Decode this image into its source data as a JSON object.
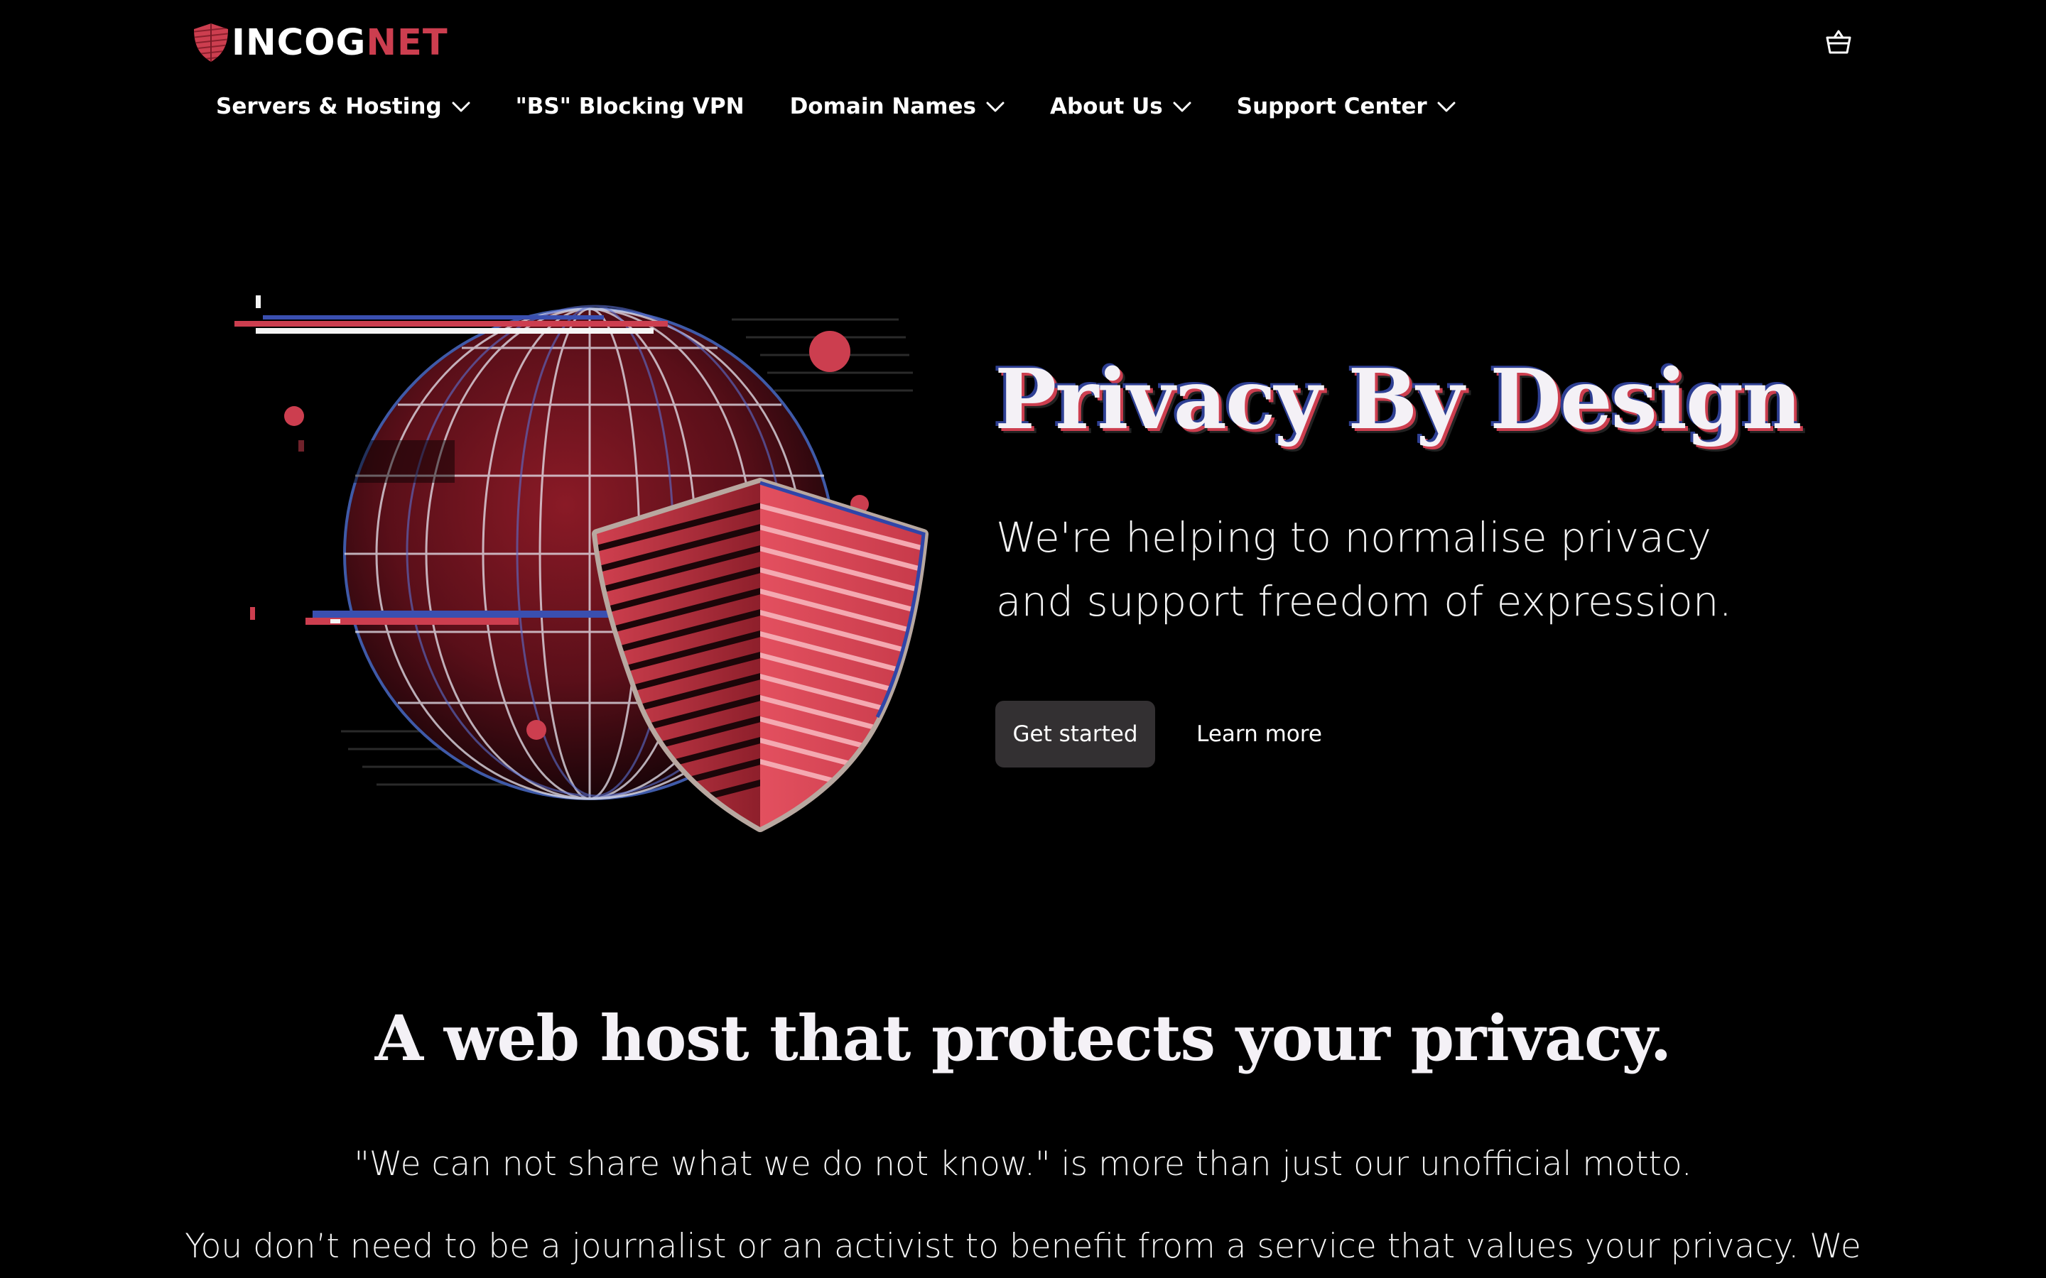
{
  "brand": {
    "name_part1": "INCOG",
    "name_part2": "NET",
    "accent_color": "#cc3e4f",
    "secondary_color": "#2e3f93",
    "logo_icon": "shield-icon"
  },
  "header": {
    "cart_icon": "basket-icon"
  },
  "nav": {
    "items": [
      {
        "label": "Servers & Hosting",
        "has_dropdown": true
      },
      {
        "label": "\"BS\" Blocking VPN",
        "has_dropdown": false
      },
      {
        "label": "Domain Names",
        "has_dropdown": true
      },
      {
        "label": "About Us",
        "has_dropdown": true
      },
      {
        "label": "Support Center",
        "has_dropdown": true
      }
    ],
    "dropdown_icon": "chevron-down-icon"
  },
  "hero": {
    "title": "Privacy By Design",
    "subtitle": "We're helping to normalise privacy and support freedom of expression.",
    "primary_button": "Get started",
    "secondary_button": "Learn more",
    "illustration": "globe-with-shield-illustration"
  },
  "section": {
    "title": "A web host that protects your privacy.",
    "motto": "\"We can not share what we do not know.\" is more than just our unofficial motto.",
    "body": "You don’t need to be a journalist or an activist to benefit from a service that values your privacy. We"
  }
}
